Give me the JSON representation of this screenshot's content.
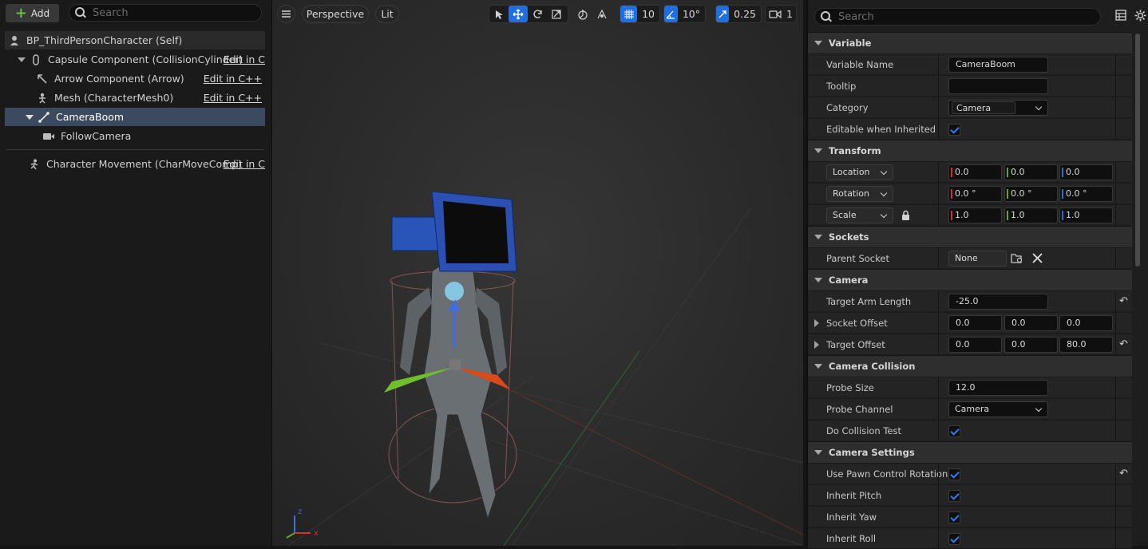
{
  "components": {
    "add_label": "Add",
    "search_placeholder": "Search",
    "items": [
      {
        "label": "BP_ThirdPersonCharacter (Self)",
        "edit": ""
      },
      {
        "label": "Capsule Component (CollisionCylinder)",
        "edit": "Edit in C"
      },
      {
        "label": "Arrow Component (Arrow)",
        "edit": "Edit in C++"
      },
      {
        "label": "Mesh (CharacterMesh0)",
        "edit": "Edit in C++"
      },
      {
        "label": "CameraBoom",
        "edit": ""
      },
      {
        "label": "FollowCamera",
        "edit": ""
      },
      {
        "label": "Character Movement (CharMoveComp)",
        "edit": "Edit in C"
      }
    ]
  },
  "viewport": {
    "menu_icon": "hamburger-icon",
    "perspective_label": "Perspective",
    "lit_label": "Lit",
    "grid_value": "10",
    "angle_value": "10°",
    "scale_value": "0.25",
    "camera_speed": "1",
    "axis_x": "x",
    "axis_z": "z"
  },
  "details": {
    "search_placeholder": "Search",
    "sections": {
      "variable": "Variable",
      "transform": "Transform",
      "sockets": "Sockets",
      "camera": "Camera",
      "camera_collision": "Camera Collision",
      "camera_settings": "Camera Settings"
    },
    "variable": {
      "name_label": "Variable Name",
      "name_value": "CameraBoom",
      "tooltip_label": "Tooltip",
      "tooltip_value": "",
      "category_label": "Category",
      "category_value": "Camera",
      "editable_label": "Editable when Inherited"
    },
    "transform": {
      "location_label": "Location",
      "location": [
        "0.0",
        "0.0",
        "0.0"
      ],
      "rotation_label": "Rotation",
      "rotation": [
        "0.0 °",
        "0.0 °",
        "0.0 °"
      ],
      "scale_label": "Scale",
      "scale": [
        "1.0",
        "1.0",
        "1.0"
      ]
    },
    "sockets": {
      "parent_label": "Parent Socket",
      "parent_value": "None"
    },
    "camera": {
      "arm_label": "Target Arm Length",
      "arm_value": "-25.0",
      "socket_offset_label": "Socket Offset",
      "socket_offset": [
        "0.0",
        "0.0",
        "0.0"
      ],
      "target_offset_label": "Target Offset",
      "target_offset": [
        "0.0",
        "0.0",
        "80.0"
      ]
    },
    "camera_collision": {
      "probe_size_label": "Probe Size",
      "probe_size_value": "12.0",
      "probe_channel_label": "Probe Channel",
      "probe_channel_value": "Camera",
      "collision_test_label": "Do Collision Test"
    },
    "camera_settings": {
      "pawn_rotation_label": "Use Pawn Control Rotation",
      "pitch_label": "Inherit Pitch",
      "yaw_label": "Inherit Yaw",
      "roll_label": "Inherit Roll"
    }
  }
}
